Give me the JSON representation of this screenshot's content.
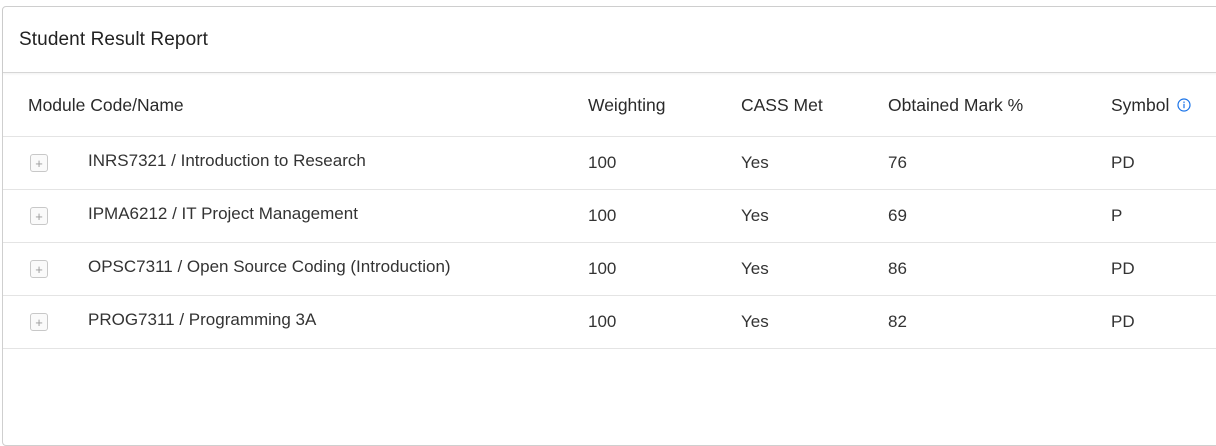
{
  "panel": {
    "title": "Student Result Report"
  },
  "table": {
    "headers": {
      "module": "Module Code/Name",
      "weighting": "Weighting",
      "cass_met": "CASS Met",
      "obtained_mark": "Obtained Mark %",
      "symbol": "Symbol"
    },
    "header_icon": "info-icon",
    "expand_icon": "plus-icon",
    "accent_color": "#1a73e8",
    "rows": [
      {
        "expand": "+",
        "module": "INRS7321 / Introduction to Research",
        "weighting": "100",
        "cass_met": "Yes",
        "obtained_mark": "76",
        "symbol": "PD"
      },
      {
        "expand": "+",
        "module": "IPMA6212 / IT Project Management",
        "weighting": "100",
        "cass_met": "Yes",
        "obtained_mark": "69",
        "symbol": "P"
      },
      {
        "expand": "+",
        "module": "OPSC7311 / Open Source Coding (Introduction)",
        "weighting": "100",
        "cass_met": "Yes",
        "obtained_mark": "86",
        "symbol": "PD"
      },
      {
        "expand": "+",
        "module": "PROG7311 / Programming 3A",
        "weighting": "100",
        "cass_met": "Yes",
        "obtained_mark": "82",
        "symbol": "PD"
      }
    ]
  }
}
